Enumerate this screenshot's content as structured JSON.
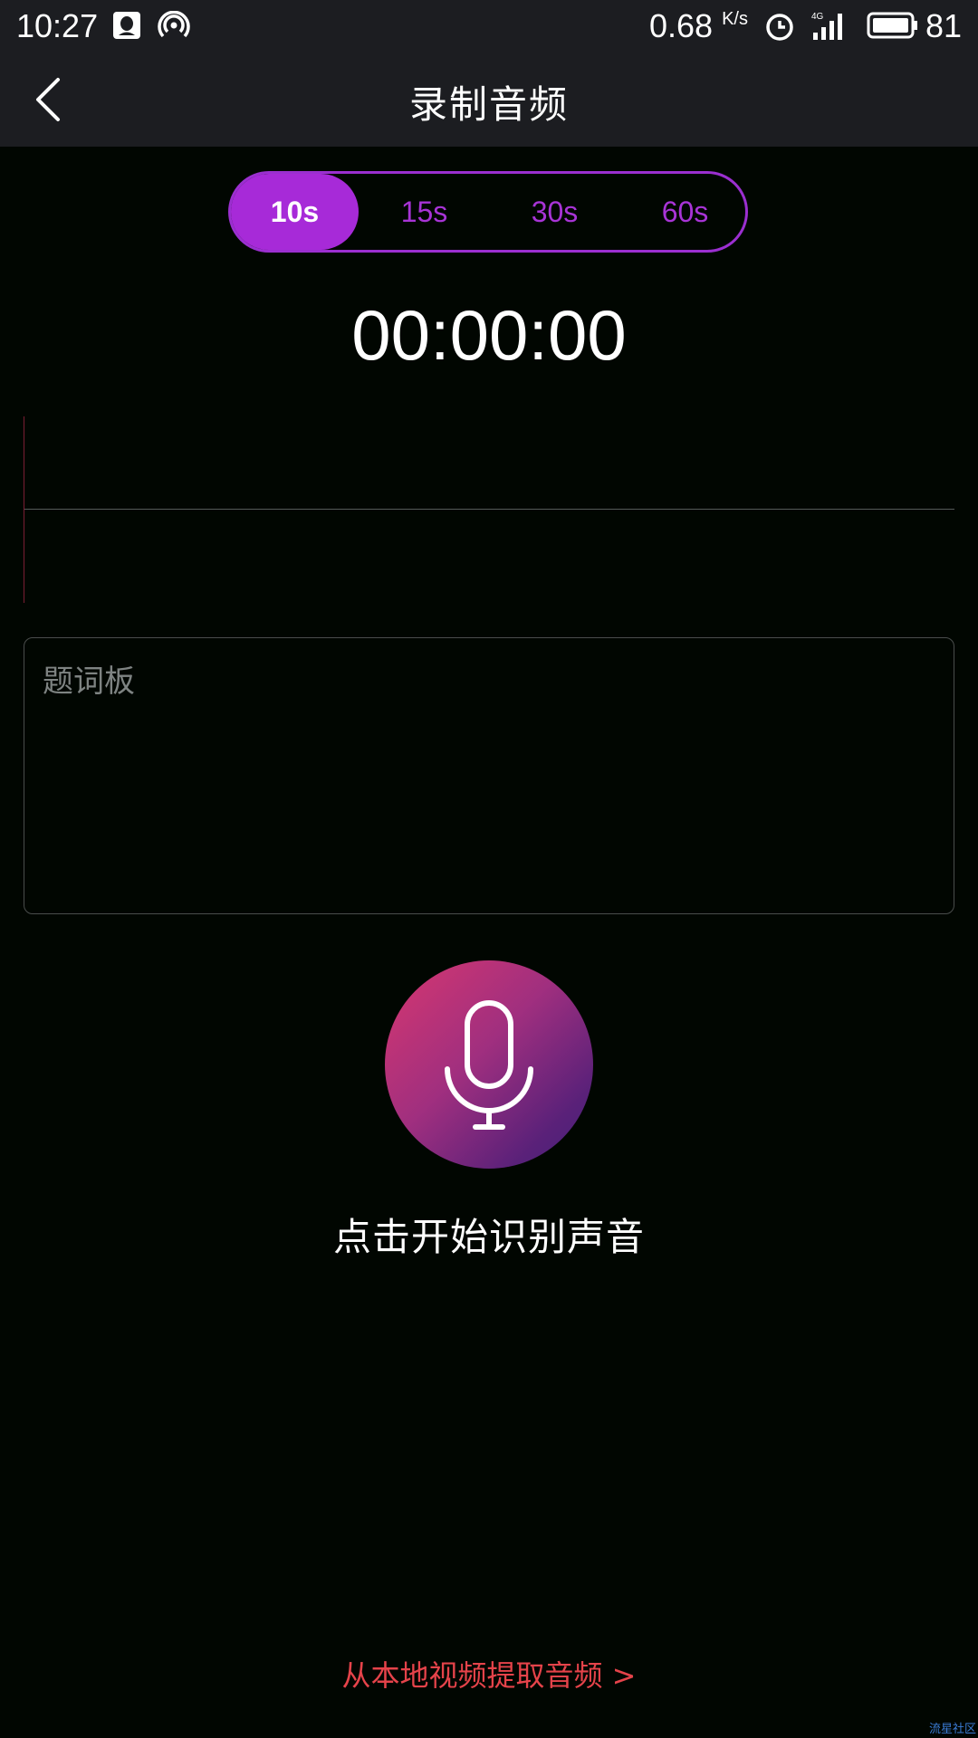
{
  "status_bar": {
    "time": "10:27",
    "speed": "0.68",
    "speed_unit": "K/s",
    "battery": "81",
    "icons": [
      "qq-icon",
      "hotspot-icon",
      "alarm-icon",
      "signal-4g-icon",
      "battery-icon"
    ]
  },
  "header": {
    "title": "录制音频",
    "back_icon": "chevron-left-icon"
  },
  "duration_selector": {
    "options": [
      "10s",
      "15s",
      "30s",
      "60s"
    ],
    "selected": "10s"
  },
  "timer": "00:00:00",
  "prompt_board": {
    "placeholder": "题词板",
    "value": ""
  },
  "record": {
    "icon": "microphone-icon",
    "label": "点击开始识别声音"
  },
  "local_video_link": "从本地视频提取音频 >",
  "watermark": "流星社区",
  "colors": {
    "accent_purple": "#a72ad8",
    "link_red": "#e5434a",
    "background": "#010601",
    "bar": "#1c1d21"
  }
}
